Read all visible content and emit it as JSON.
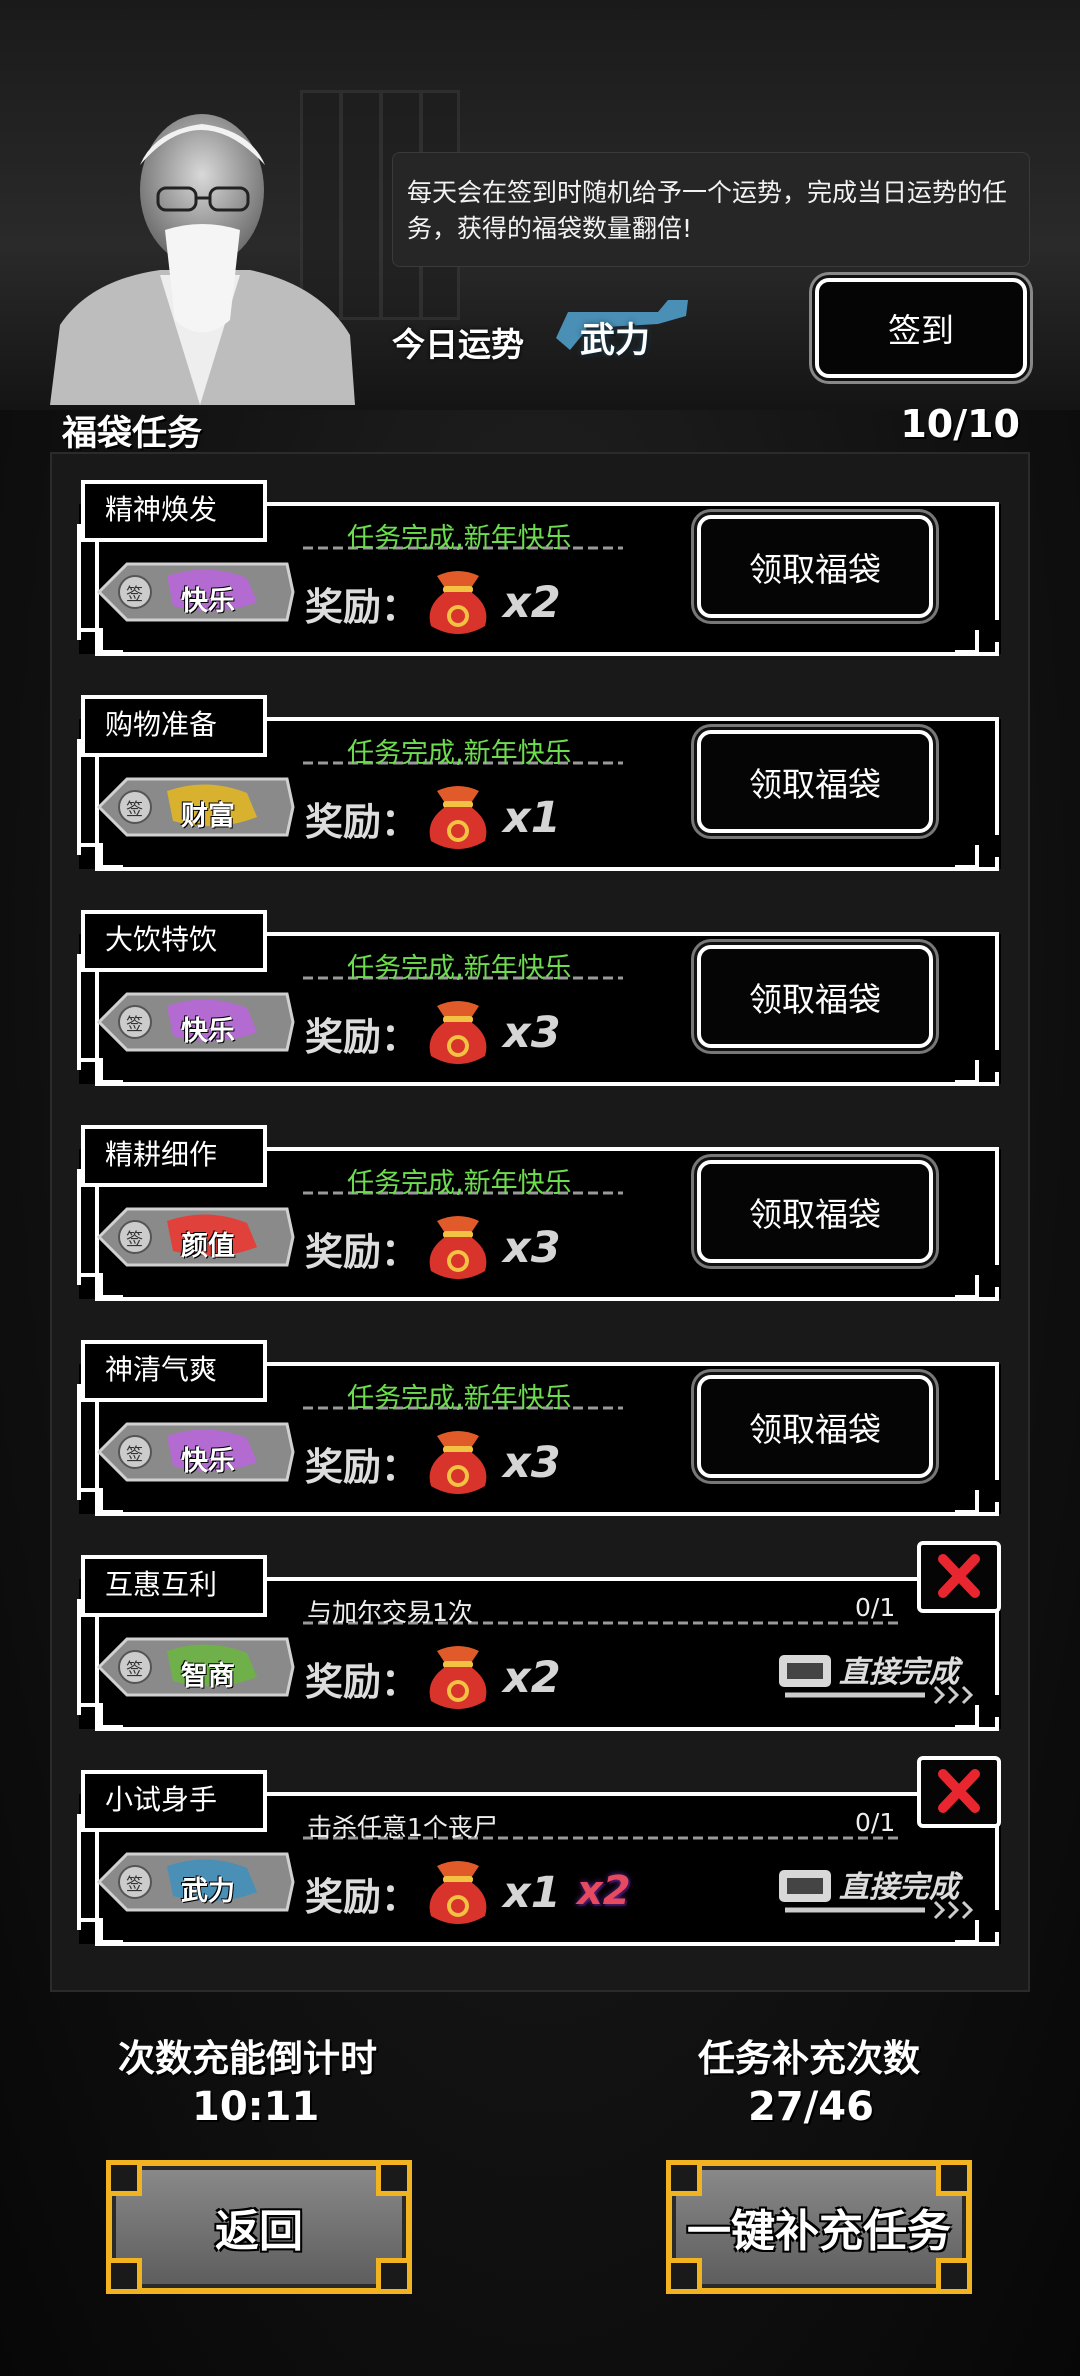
{
  "header": {
    "description": "每天会在签到时随机给予一个运势，完成当日运势的任务，获得的福袋数量翻倍!",
    "fortune_label": "今日运势",
    "fortune_value": "武力",
    "signin_label": "签到"
  },
  "section": {
    "title": "福袋任务",
    "count": "10/10"
  },
  "reward_label": "奖励：",
  "tasks": [
    {
      "name": "精神焕发",
      "status": "任务完成,新年快乐",
      "tag": "快乐",
      "multiplier": "x2",
      "action": "领取福袋"
    },
    {
      "name": "购物准备",
      "status": "任务完成,新年快乐",
      "tag": "财富",
      "multiplier": "x1",
      "action": "领取福袋"
    },
    {
      "name": "大饮特饮",
      "status": "任务完成,新年快乐",
      "tag": "快乐",
      "multiplier": "x3",
      "action": "领取福袋"
    },
    {
      "name": "精耕细作",
      "status": "任务完成,新年快乐",
      "tag": "颜值",
      "multiplier": "x3",
      "action": "领取福袋"
    },
    {
      "name": "神清气爽",
      "status": "任务完成,新年快乐",
      "tag": "快乐",
      "multiplier": "x3",
      "action": "领取福袋"
    },
    {
      "name": "互惠互利",
      "goal": "与加尔交易1次",
      "progress": "0/1",
      "tag": "智商",
      "multiplier": "x2",
      "action": "直接完成"
    },
    {
      "name": "小试身手",
      "goal": "击杀任意1个丧尸",
      "progress": "0/1",
      "tag": "武力",
      "multiplier": "x1",
      "bonus": "x2",
      "action": "直接完成"
    }
  ],
  "tag_prefix": "签",
  "footer": {
    "countdown_label": "次数充能倒计时",
    "countdown_value": "10:11",
    "refill_label": "任务补充次数",
    "refill_value": "27/46",
    "back_label": "返回",
    "refill_button_label": "一键补充任务"
  },
  "colors": {
    "complete_green": "#6ddc4f",
    "gold_border": "#f2b321",
    "tag_happy": "#b36bd1",
    "tag_wealth": "#d8b22e",
    "tag_beauty": "#e0413a",
    "tag_iq": "#6fb04a",
    "tag_force": "#4a8fb5",
    "bonus_red": "#e64a5f"
  }
}
